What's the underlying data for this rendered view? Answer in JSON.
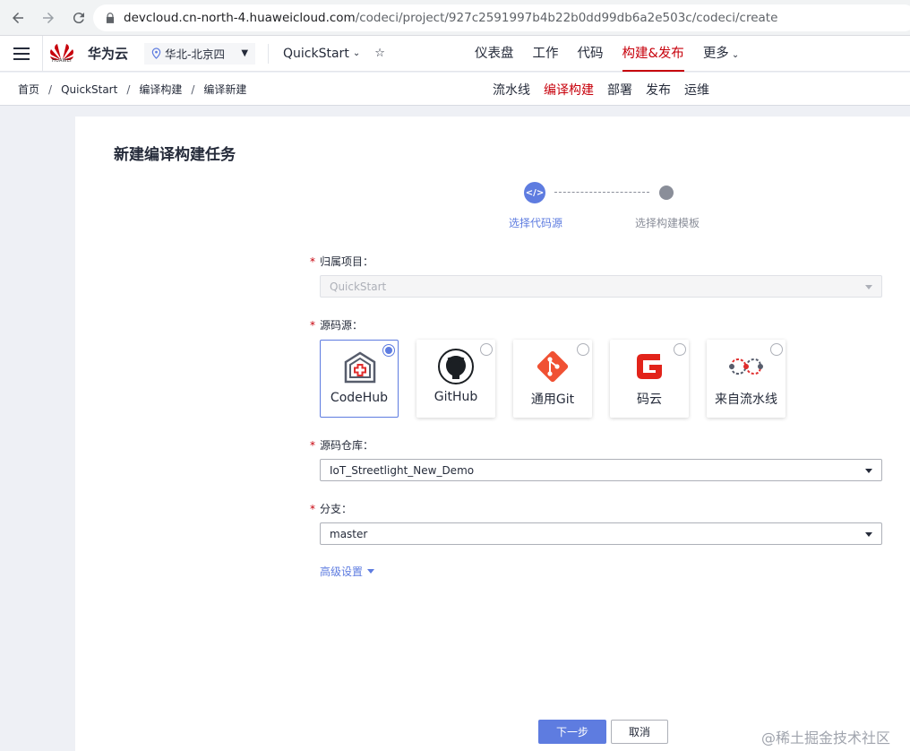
{
  "browser": {
    "url_host": "devcloud.cn-north-4.huaweicloud.com",
    "url_path": "/codeci/project/927c2591997b4b22b0dd99db6a2e503c/codeci/create"
  },
  "header": {
    "logo_text": "HUAWEI",
    "brand": "华为云",
    "region": "华北-北京四",
    "project": "QuickStart",
    "nav": [
      "仪表盘",
      "工作",
      "代码",
      "构建&发布",
      "更多"
    ]
  },
  "subheader": {
    "breadcrumb": [
      "首页",
      "QuickStart",
      "编译构建",
      "编译新建"
    ],
    "nav": [
      "流水线",
      "编译构建",
      "部署",
      "发布",
      "运维"
    ]
  },
  "page": {
    "title": "新建编译构建任务"
  },
  "steps": {
    "step1_icon": "</>",
    "step1": "选择代码源",
    "step2": "选择构建模板"
  },
  "form": {
    "project_label": "归属项目：",
    "project_value": "QuickStart",
    "source_label": "源码源：",
    "sources": [
      "CodeHub",
      "GitHub",
      "通用Git",
      "码云",
      "来自流水线"
    ],
    "repo_label": "源码仓库：",
    "repo_value": "IoT_Streetlight_New_Demo",
    "branch_label": "分支：",
    "branch_value": "master",
    "advanced": "高级设置",
    "required_mark": "*"
  },
  "actions": {
    "next": "下一步",
    "cancel": "取消"
  },
  "watermark": "@稀土掘金技术社区",
  "colors": {
    "accent": "#5e7ce0",
    "brand_red": "#c7000b"
  }
}
